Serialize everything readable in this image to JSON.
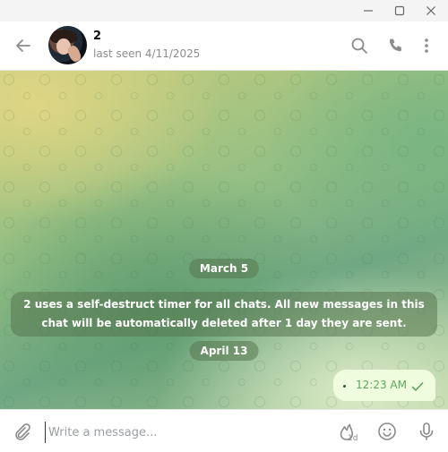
{
  "window": {
    "minimize_icon": "minimize-icon",
    "maximize_icon": "maximize-icon",
    "close_icon": "close-icon"
  },
  "header": {
    "name": "2",
    "status": "last seen 4/11/2025",
    "icons": [
      "back-arrow-icon",
      "search-icon",
      "phone-icon",
      "more-vertical-icon"
    ]
  },
  "messages": {
    "date1": "March 5",
    "service_text": "2 uses a self-destruct timer for all chats. All new messages in this chat will be automatically deleted after 1 day they are sent.",
    "date2": "April 13",
    "outgoing": {
      "time": "12:23 AM",
      "status_icon": "check-icon"
    }
  },
  "composer": {
    "placeholder": "Write a message...",
    "timer_label": "1d",
    "icons": [
      "attach-icon",
      "self-destruct-timer-icon",
      "emoji-icon",
      "microphone-icon"
    ]
  },
  "colors": {
    "bubble": "#effdde",
    "accent": "#5ea75d",
    "icon": "#8b8b8b"
  }
}
